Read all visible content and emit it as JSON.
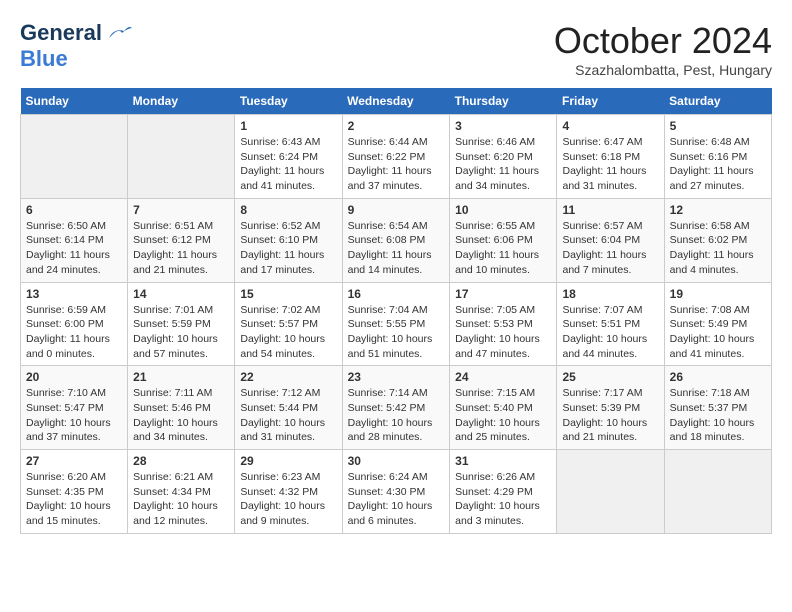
{
  "logo": {
    "general": "General",
    "blue": "Blue"
  },
  "title": "October 2024",
  "location": "Szazhalombatta, Pest, Hungary",
  "days_of_week": [
    "Sunday",
    "Monday",
    "Tuesday",
    "Wednesday",
    "Thursday",
    "Friday",
    "Saturday"
  ],
  "weeks": [
    [
      {
        "day": "",
        "empty": true
      },
      {
        "day": "",
        "empty": true
      },
      {
        "day": "1",
        "sunrise": "Sunrise: 6:43 AM",
        "sunset": "Sunset: 6:24 PM",
        "daylight": "Daylight: 11 hours and 41 minutes."
      },
      {
        "day": "2",
        "sunrise": "Sunrise: 6:44 AM",
        "sunset": "Sunset: 6:22 PM",
        "daylight": "Daylight: 11 hours and 37 minutes."
      },
      {
        "day": "3",
        "sunrise": "Sunrise: 6:46 AM",
        "sunset": "Sunset: 6:20 PM",
        "daylight": "Daylight: 11 hours and 34 minutes."
      },
      {
        "day": "4",
        "sunrise": "Sunrise: 6:47 AM",
        "sunset": "Sunset: 6:18 PM",
        "daylight": "Daylight: 11 hours and 31 minutes."
      },
      {
        "day": "5",
        "sunrise": "Sunrise: 6:48 AM",
        "sunset": "Sunset: 6:16 PM",
        "daylight": "Daylight: 11 hours and 27 minutes."
      }
    ],
    [
      {
        "day": "6",
        "sunrise": "Sunrise: 6:50 AM",
        "sunset": "Sunset: 6:14 PM",
        "daylight": "Daylight: 11 hours and 24 minutes."
      },
      {
        "day": "7",
        "sunrise": "Sunrise: 6:51 AM",
        "sunset": "Sunset: 6:12 PM",
        "daylight": "Daylight: 11 hours and 21 minutes."
      },
      {
        "day": "8",
        "sunrise": "Sunrise: 6:52 AM",
        "sunset": "Sunset: 6:10 PM",
        "daylight": "Daylight: 11 hours and 17 minutes."
      },
      {
        "day": "9",
        "sunrise": "Sunrise: 6:54 AM",
        "sunset": "Sunset: 6:08 PM",
        "daylight": "Daylight: 11 hours and 14 minutes."
      },
      {
        "day": "10",
        "sunrise": "Sunrise: 6:55 AM",
        "sunset": "Sunset: 6:06 PM",
        "daylight": "Daylight: 11 hours and 10 minutes."
      },
      {
        "day": "11",
        "sunrise": "Sunrise: 6:57 AM",
        "sunset": "Sunset: 6:04 PM",
        "daylight": "Daylight: 11 hours and 7 minutes."
      },
      {
        "day": "12",
        "sunrise": "Sunrise: 6:58 AM",
        "sunset": "Sunset: 6:02 PM",
        "daylight": "Daylight: 11 hours and 4 minutes."
      }
    ],
    [
      {
        "day": "13",
        "sunrise": "Sunrise: 6:59 AM",
        "sunset": "Sunset: 6:00 PM",
        "daylight": "Daylight: 11 hours and 0 minutes."
      },
      {
        "day": "14",
        "sunrise": "Sunrise: 7:01 AM",
        "sunset": "Sunset: 5:59 PM",
        "daylight": "Daylight: 10 hours and 57 minutes."
      },
      {
        "day": "15",
        "sunrise": "Sunrise: 7:02 AM",
        "sunset": "Sunset: 5:57 PM",
        "daylight": "Daylight: 10 hours and 54 minutes."
      },
      {
        "day": "16",
        "sunrise": "Sunrise: 7:04 AM",
        "sunset": "Sunset: 5:55 PM",
        "daylight": "Daylight: 10 hours and 51 minutes."
      },
      {
        "day": "17",
        "sunrise": "Sunrise: 7:05 AM",
        "sunset": "Sunset: 5:53 PM",
        "daylight": "Daylight: 10 hours and 47 minutes."
      },
      {
        "day": "18",
        "sunrise": "Sunrise: 7:07 AM",
        "sunset": "Sunset: 5:51 PM",
        "daylight": "Daylight: 10 hours and 44 minutes."
      },
      {
        "day": "19",
        "sunrise": "Sunrise: 7:08 AM",
        "sunset": "Sunset: 5:49 PM",
        "daylight": "Daylight: 10 hours and 41 minutes."
      }
    ],
    [
      {
        "day": "20",
        "sunrise": "Sunrise: 7:10 AM",
        "sunset": "Sunset: 5:47 PM",
        "daylight": "Daylight: 10 hours and 37 minutes."
      },
      {
        "day": "21",
        "sunrise": "Sunrise: 7:11 AM",
        "sunset": "Sunset: 5:46 PM",
        "daylight": "Daylight: 10 hours and 34 minutes."
      },
      {
        "day": "22",
        "sunrise": "Sunrise: 7:12 AM",
        "sunset": "Sunset: 5:44 PM",
        "daylight": "Daylight: 10 hours and 31 minutes."
      },
      {
        "day": "23",
        "sunrise": "Sunrise: 7:14 AM",
        "sunset": "Sunset: 5:42 PM",
        "daylight": "Daylight: 10 hours and 28 minutes."
      },
      {
        "day": "24",
        "sunrise": "Sunrise: 7:15 AM",
        "sunset": "Sunset: 5:40 PM",
        "daylight": "Daylight: 10 hours and 25 minutes."
      },
      {
        "day": "25",
        "sunrise": "Sunrise: 7:17 AM",
        "sunset": "Sunset: 5:39 PM",
        "daylight": "Daylight: 10 hours and 21 minutes."
      },
      {
        "day": "26",
        "sunrise": "Sunrise: 7:18 AM",
        "sunset": "Sunset: 5:37 PM",
        "daylight": "Daylight: 10 hours and 18 minutes."
      }
    ],
    [
      {
        "day": "27",
        "sunrise": "Sunrise: 6:20 AM",
        "sunset": "Sunset: 4:35 PM",
        "daylight": "Daylight: 10 hours and 15 minutes."
      },
      {
        "day": "28",
        "sunrise": "Sunrise: 6:21 AM",
        "sunset": "Sunset: 4:34 PM",
        "daylight": "Daylight: 10 hours and 12 minutes."
      },
      {
        "day": "29",
        "sunrise": "Sunrise: 6:23 AM",
        "sunset": "Sunset: 4:32 PM",
        "daylight": "Daylight: 10 hours and 9 minutes."
      },
      {
        "day": "30",
        "sunrise": "Sunrise: 6:24 AM",
        "sunset": "Sunset: 4:30 PM",
        "daylight": "Daylight: 10 hours and 6 minutes."
      },
      {
        "day": "31",
        "sunrise": "Sunrise: 6:26 AM",
        "sunset": "Sunset: 4:29 PM",
        "daylight": "Daylight: 10 hours and 3 minutes."
      },
      {
        "day": "",
        "empty": true
      },
      {
        "day": "",
        "empty": true
      }
    ]
  ]
}
